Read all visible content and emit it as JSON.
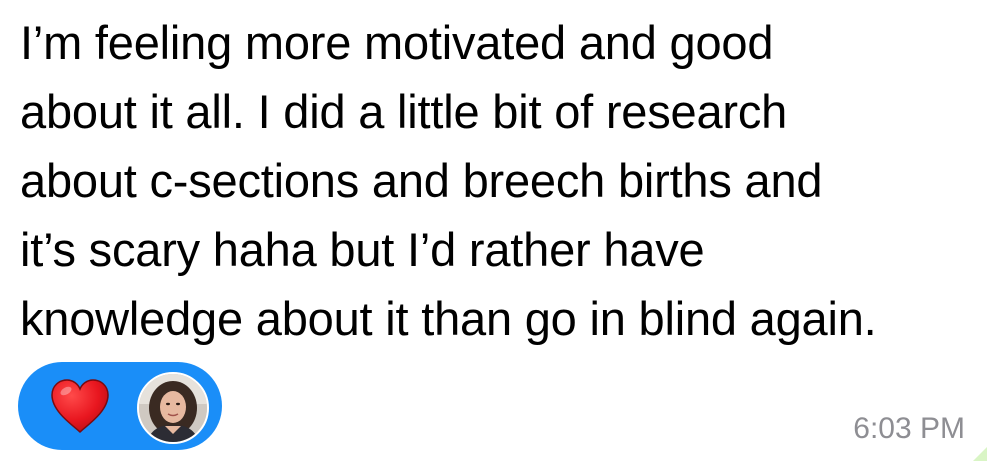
{
  "message": {
    "lines": [
      "I’m feeling more motivated and good",
      "about it all. I did a little bit of research",
      "about c-sections and breech births and",
      "it’s scary haha but I’d rather have",
      "knowledge about it than go in blind again."
    ],
    "timestamp": "6:03 PM"
  },
  "reaction": {
    "icon": "heart-icon",
    "avatar": "avatar",
    "pill_color": "#1a8ef8",
    "heart_color": "#e8161f"
  }
}
